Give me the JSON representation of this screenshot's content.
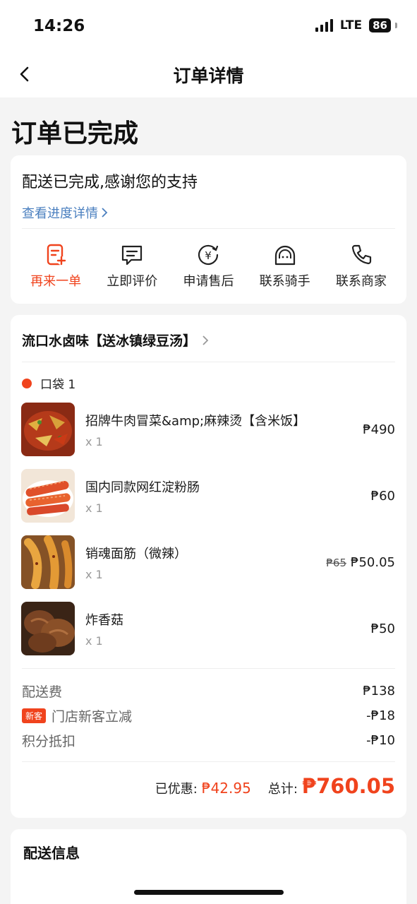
{
  "status_bar": {
    "time": "14:26",
    "network": "LTE",
    "battery": "86"
  },
  "nav": {
    "title": "订单详情"
  },
  "order_status": {
    "title": "订单已完成",
    "message": "配送已完成,感谢您的支持",
    "progress_link": "查看进度详情"
  },
  "actions": [
    {
      "label": "再来一单",
      "icon": "reorder-icon"
    },
    {
      "label": "立即评价",
      "icon": "review-icon"
    },
    {
      "label": "申请售后",
      "icon": "refund-icon"
    },
    {
      "label": "联系骑手",
      "icon": "rider-icon"
    },
    {
      "label": "联系商家",
      "icon": "phone-icon"
    }
  ],
  "shop": {
    "name": "流口水卤味【送冰镇绿豆汤】",
    "bag_label": "口袋 1"
  },
  "items": [
    {
      "name": "招牌牛肉冒菜&amp;麻辣烫【含米饭】",
      "qty": "x 1",
      "price": "₱490",
      "original_price": ""
    },
    {
      "name": "国内同款网红淀粉肠",
      "qty": "x 1",
      "price": "₱60",
      "original_price": ""
    },
    {
      "name": "销魂面筋（微辣）",
      "qty": "x 1",
      "price": "₱50.05",
      "original_price": "₱65"
    },
    {
      "name": "炸香菇",
      "qty": "x 1",
      "price": "₱50",
      "original_price": ""
    }
  ],
  "fees": {
    "delivery_label": "配送费",
    "delivery_value": "₱138",
    "new_badge": "新客",
    "new_discount_label": "门店新客立减",
    "new_discount_value": "-₱18",
    "points_label": "积分抵扣",
    "points_value": "-₱10"
  },
  "totals": {
    "discount_label": "已优惠:",
    "discount_value": "₱42.95",
    "total_label": "总计:",
    "total_value": "₱760.05"
  },
  "delivery": {
    "title": "配送信息"
  },
  "colors": {
    "accent": "#f0431d",
    "link": "#4a7fbf"
  }
}
